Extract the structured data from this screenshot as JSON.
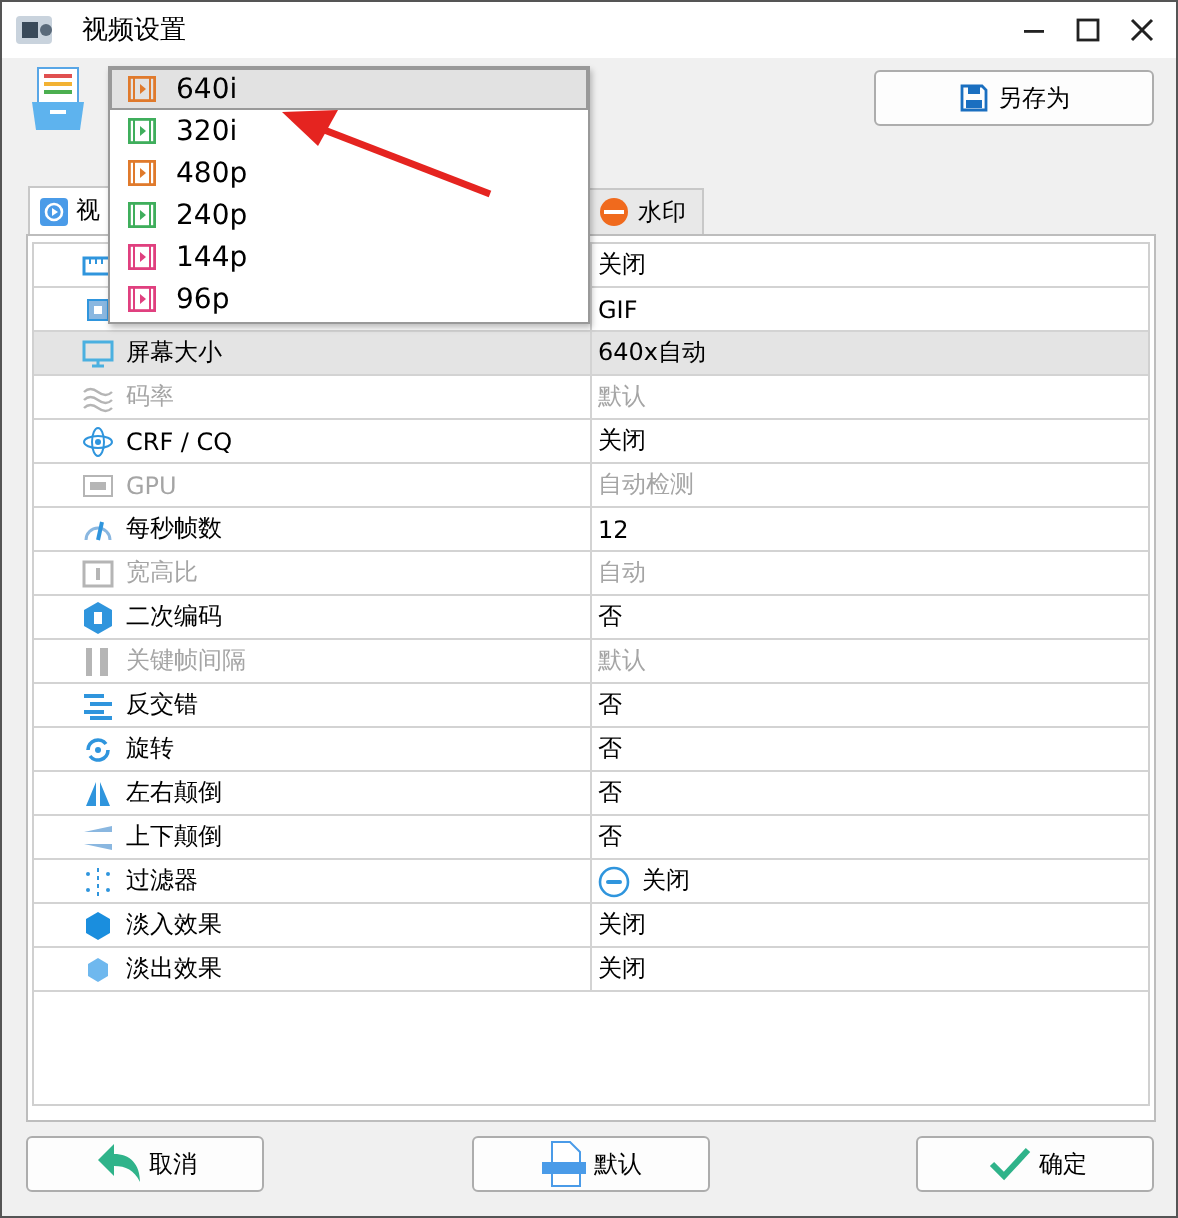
{
  "window": {
    "title": "视频设置"
  },
  "presets": {
    "items": [
      {
        "label": "640i",
        "selected": true,
        "color": "#e07a2c"
      },
      {
        "label": "320i",
        "selected": false,
        "color": "#3fae5c"
      },
      {
        "label": "480p",
        "selected": false,
        "color": "#e07a2c"
      },
      {
        "label": "240p",
        "selected": false,
        "color": "#3fae5c"
      },
      {
        "label": "144p",
        "selected": false,
        "color": "#e0407f"
      },
      {
        "label": "96p",
        "selected": false,
        "color": "#e0407f"
      }
    ]
  },
  "save_as_button": "另存为",
  "tabs": [
    {
      "label": "视",
      "selected": true
    },
    {
      "label": "水印",
      "selected": false
    }
  ],
  "settings": {
    "rows": [
      {
        "value": "关闭",
        "disabled": false,
        "selected": false
      },
      {
        "value": "GIF",
        "disabled": false,
        "selected": false
      },
      {
        "label": "屏幕大小",
        "value": "640x自动",
        "disabled": false,
        "selected": true
      },
      {
        "label": "码率",
        "value": "默认",
        "disabled": true,
        "selected": false
      },
      {
        "label": "CRF / CQ",
        "value": "关闭",
        "disabled": false,
        "selected": false
      },
      {
        "label": "GPU",
        "value": "自动检测",
        "disabled": true,
        "selected": false
      },
      {
        "label": "每秒帧数",
        "value": "12",
        "disabled": false,
        "selected": false
      },
      {
        "label": "宽高比",
        "value": "自动",
        "disabled": true,
        "selected": false
      },
      {
        "label": "二次编码",
        "value": "否",
        "disabled": false,
        "selected": false
      },
      {
        "label": "关键帧间隔",
        "value": "默认",
        "disabled": true,
        "selected": false
      },
      {
        "label": "反交错",
        "value": "否",
        "disabled": false,
        "selected": false
      },
      {
        "label": "旋转",
        "value": "否",
        "disabled": false,
        "selected": false
      },
      {
        "label": "左右颠倒",
        "value": "否",
        "disabled": false,
        "selected": false
      },
      {
        "label": "上下颠倒",
        "value": "否",
        "disabled": false,
        "selected": false
      },
      {
        "label": "过滤器",
        "value": "关闭",
        "disabled": false,
        "selected": false,
        "kind": "toggle"
      },
      {
        "label": "淡入效果",
        "value": "关闭",
        "disabled": false,
        "selected": false
      },
      {
        "label": "淡出效果",
        "value": "关闭",
        "disabled": false,
        "selected": false
      }
    ]
  },
  "buttons": [
    "取消",
    "默认",
    "确定"
  ]
}
